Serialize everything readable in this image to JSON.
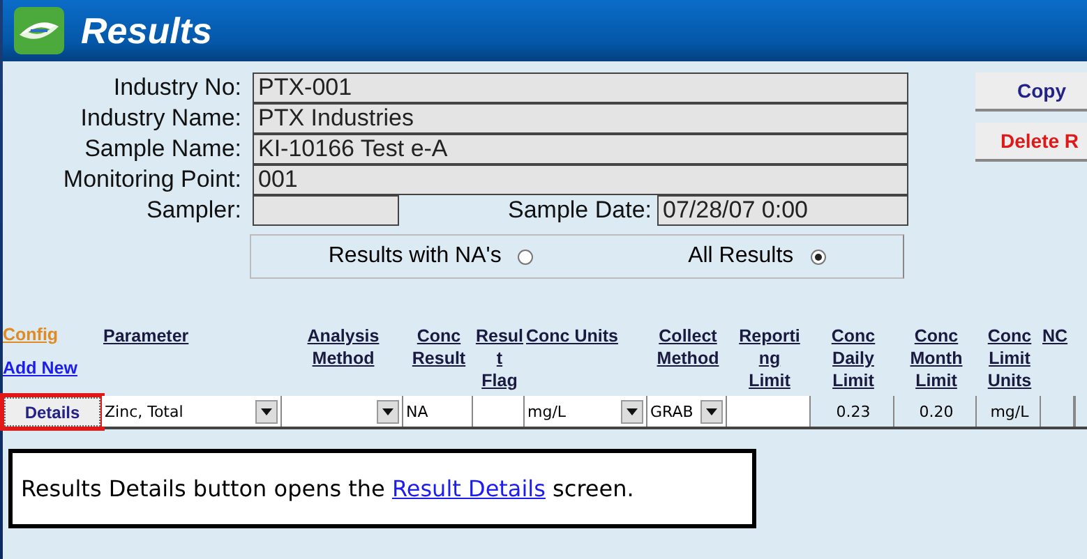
{
  "window": {
    "title": "Results"
  },
  "fields": [
    {
      "label": "Industry No:",
      "value": "PTX-001"
    },
    {
      "label": "Industry Name:",
      "value": "PTX Industries"
    },
    {
      "label": "Sample Name:",
      "value": "KI-10166 Test e-A"
    },
    {
      "label": "Monitoring Point:",
      "value": "001"
    }
  ],
  "sampler": {
    "label": "Sampler:"
  },
  "sample_date": {
    "label": "Sample Date:",
    "value": "07/28/07 0:00"
  },
  "filter": [
    {
      "label": "Results with NA's",
      "selected": false
    },
    {
      "label": "All Results",
      "selected": true
    }
  ],
  "buttons": [
    {
      "label": "Copy",
      "kind": "normal"
    },
    {
      "label": "Delete R",
      "kind": "danger"
    }
  ],
  "links": [
    {
      "label": "Config",
      "kind": "config"
    },
    {
      "label": "Add New",
      "kind": "add"
    }
  ],
  "columns": [
    {
      "lines": [
        "Parameter"
      ]
    },
    {
      "lines": [
        "Analysis",
        "Method"
      ]
    },
    {
      "lines": [
        "Conc",
        "Result"
      ]
    },
    {
      "lines": [
        "Resul",
        "t",
        "Flag"
      ]
    },
    {
      "lines": [
        "Conc Units"
      ]
    },
    {
      "lines": [
        "Collect",
        "Method"
      ]
    },
    {
      "lines": [
        "Reporti",
        "ng",
        "Limit"
      ]
    },
    {
      "lines": [
        "Conc",
        "Daily",
        "Limit"
      ]
    },
    {
      "lines": [
        "Conc",
        "Month",
        "Limit"
      ]
    },
    {
      "lines": [
        "Conc",
        "Limit",
        "Units"
      ]
    },
    {
      "lines": [
        "NC"
      ]
    }
  ],
  "row": {
    "button": "Details",
    "highlight": true,
    "cells": [
      {
        "kind": "combo",
        "value": "Zinc, Total"
      },
      {
        "kind": "combo"
      },
      {
        "kind": "text",
        "value": "NA"
      },
      {
        "kind": "text"
      },
      {
        "kind": "combo",
        "value": "mg/L"
      },
      {
        "kind": "combo",
        "value": "GRAB"
      },
      {
        "kind": "text"
      },
      {
        "kind": "readonly",
        "value": "0.23"
      },
      {
        "kind": "readonly",
        "value": "0.20"
      },
      {
        "kind": "readonly",
        "value": "mg/L"
      },
      {
        "kind": "readonly"
      }
    ]
  },
  "note": {
    "before": "Results Details button opens the ",
    "link": "Result Details",
    "after": " screen."
  }
}
